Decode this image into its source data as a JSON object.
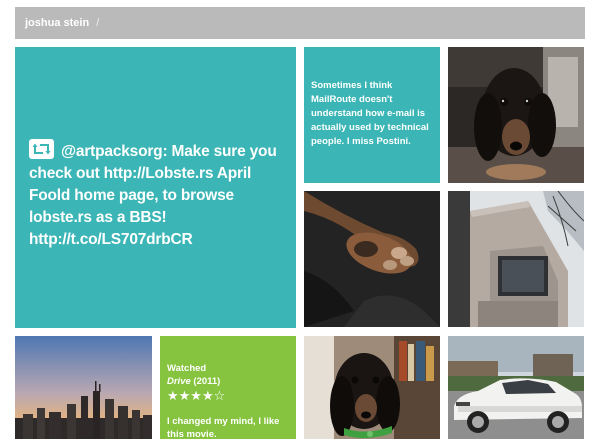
{
  "breadcrumb": {
    "home": "joshua stein",
    "separator": "/"
  },
  "tweets": {
    "big": "@artpacksorg: Make sure you check out http://Lobste.rs April Foold home page, to browse lobste.rs as a BBS! http://t.co/LS707drbCR",
    "small": "Sometimes I think MailRoute doesn't understand how e-mail is actually used by technical people. I miss Postini."
  },
  "movie": {
    "label": "Watched",
    "title": "Drive",
    "year": "(2011)",
    "stars": "★★★★☆",
    "rating": 4,
    "review": "I changed my mind, I like this movie."
  },
  "colors": {
    "teal": "#3bb5b5",
    "green": "#86c440",
    "bar": "#bababa"
  },
  "icons": {
    "retweet": "retweet-icon"
  }
}
